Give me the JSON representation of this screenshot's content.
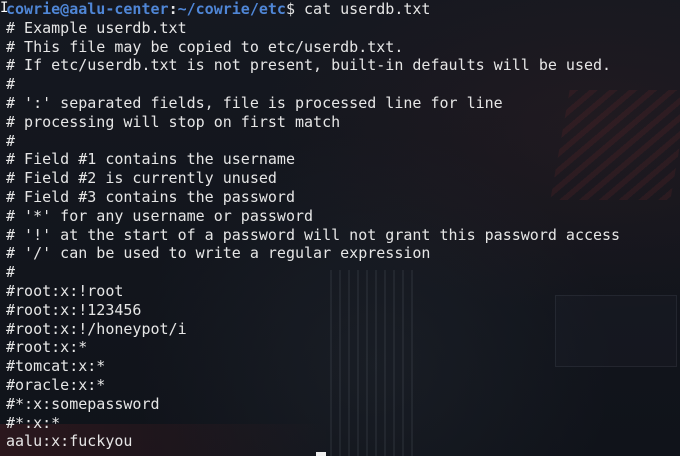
{
  "prompt": {
    "user_host": "cowrie@aalu-center",
    "colon": ":",
    "path": "~/cowrie/etc",
    "dollar": "$ ",
    "command": "cat userdb.txt"
  },
  "output": [
    "# Example userdb.txt",
    "# This file may be copied to etc/userdb.txt.",
    "# If etc/userdb.txt is not present, built-in defaults will be used.",
    "#",
    "# ':' separated fields, file is processed line for line",
    "# processing will stop on first match",
    "#",
    "# Field #1 contains the username",
    "# Field #2 is currently unused",
    "# Field #3 contains the password",
    "# '*' for any username or password",
    "# '!' at the start of a password will not grant this password access",
    "# '/' can be used to write a regular expression",
    "#",
    "#root:x:!root",
    "#root:x:!123456",
    "#root:x:!/honeypot/i",
    "#root:x:*",
    "#tomcat:x:*",
    "#oracle:x:*",
    "#*:x:somepassword",
    "#*:x:*",
    "aalu:x:fuckyou"
  ],
  "colors": {
    "background": "#11141b",
    "text": "#e6e6e6",
    "prompt_accent": "#4f86d6"
  },
  "icons": {
    "mouse_cursor": "text-cursor-icon",
    "terminal_cursor": "block-cursor-icon"
  }
}
